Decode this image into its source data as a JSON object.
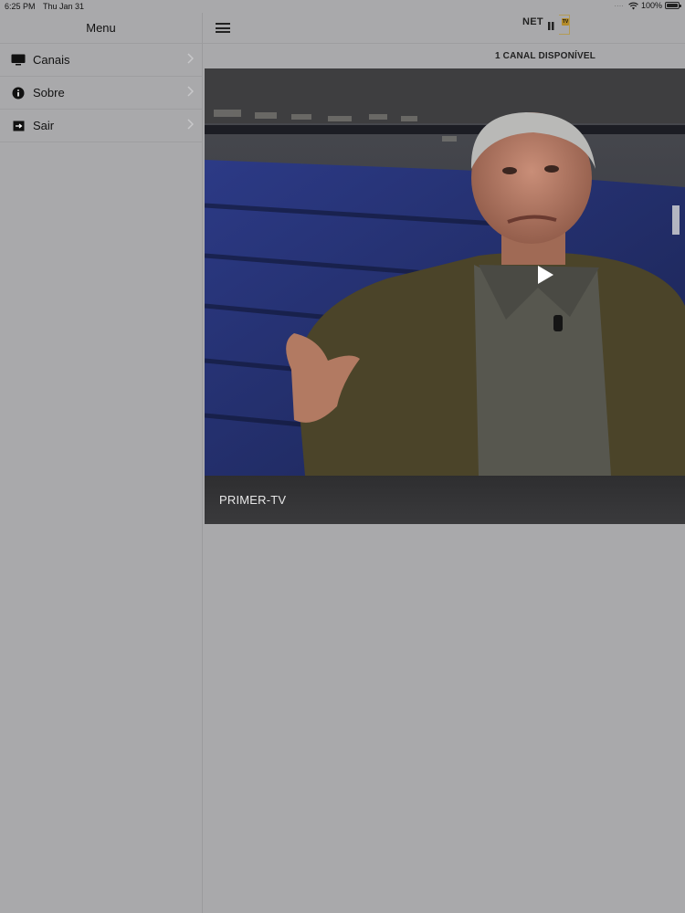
{
  "status_bar": {
    "time": "6:25 PM",
    "date": "Thu Jan 31",
    "signal_dots": "····",
    "battery": "100%",
    "battery_level": 1.0
  },
  "sidebar": {
    "title": "Menu",
    "items": [
      {
        "label": "Canais",
        "icon": "tv-icon"
      },
      {
        "label": "Sobre",
        "icon": "info-icon"
      },
      {
        "label": "Sair",
        "icon": "exit-icon"
      }
    ]
  },
  "topbar": {
    "logo_text": "NET",
    "logo_badge": "TV"
  },
  "main": {
    "channel_count_label": "1 CANAL DISPONÍVEL",
    "channels": [
      {
        "name": "PRIMER-TV"
      }
    ]
  },
  "colors": {
    "background": "#a9a9ab",
    "caption_bar": "#333335",
    "logo_accent": "#b38b28"
  }
}
